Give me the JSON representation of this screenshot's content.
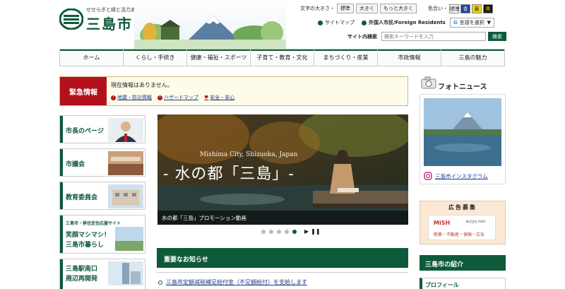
{
  "header": {
    "tagline": "せせらぎと緑と活力あふれる幸せ実感都市・三島",
    "city_name": "三島市",
    "font_size_label": "文字の大きさ・",
    "font_buttons": [
      "標準",
      "大きく",
      "もっと大きく"
    ],
    "color_label": "色合い・",
    "color_buttons": [
      "標準",
      "青",
      "黄",
      "黒"
    ],
    "sitemap": "サイトマップ",
    "foreign": "外国人市民/Foreign Residents",
    "lang_select": "言語を選択",
    "search_label": "サイト内検索",
    "search_placeholder": "検索キーワードを入力",
    "search_button": "検索"
  },
  "nav": [
    "ホーム",
    "くらし・手続き",
    "健康・福祉・スポーツ",
    "子育て・教育・文化",
    "まちづくり・産業",
    "市政情報",
    "三島の魅力"
  ],
  "emergency": {
    "title": "緊急情報",
    "message": "現在情報はありません。",
    "links": [
      "地震・防災情報",
      "ハザードマップ",
      "安全・安心"
    ]
  },
  "left_banners": [
    "市長のページ",
    "市議会",
    "教育委員会",
    "三島市・移住定住応援サイト",
    "笑顔マシマシ！",
    "三島市暮らし",
    "三島駅南口",
    "周辺再開発"
  ],
  "slideshow": {
    "subtitle": "Mishima City, Shizuoka, Japan",
    "title": "- 水の都「三島」-",
    "caption": "水の都「三島」プロモーション動画"
  },
  "notices": {
    "title": "重要なお知らせ",
    "items": [
      "三島市定額減税補足給付金（不足額給付）を支給します"
    ]
  },
  "right": {
    "photo_news": "フォトニュース",
    "instagram": "三島市インスタグラム",
    "ad_title": "広告募集",
    "ad_logo": "MiSH",
    "ad_logo_sub": "株式会社 MiSH",
    "ad_text": "新築・不動産・保険・広告",
    "intro_title": "三島市の紹介",
    "profile": "プロフィール"
  },
  "colors": {
    "brand_green": "#0e5a3a",
    "emergency_red": "#b3111b",
    "link_blue": "#1a3d8a"
  }
}
